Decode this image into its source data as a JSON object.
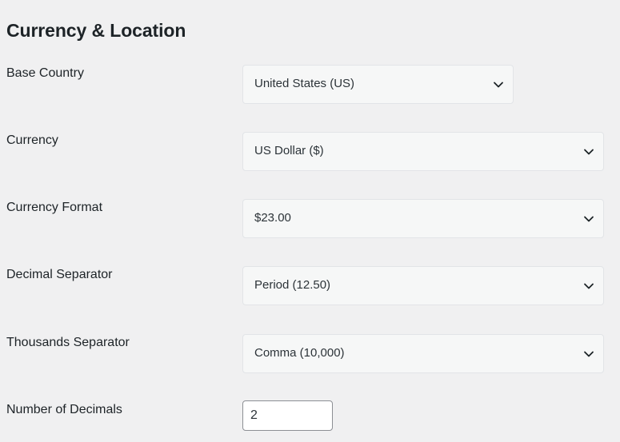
{
  "section": {
    "title": "Currency & Location"
  },
  "fields": {
    "base_country": {
      "label": "Base Country",
      "value": "United States (US)"
    },
    "currency": {
      "label": "Currency",
      "value": "US Dollar ($)"
    },
    "currency_format": {
      "label": "Currency Format",
      "value": "$23.00"
    },
    "decimal_separator": {
      "label": "Decimal Separator",
      "value": "Period (12.50)"
    },
    "thousands_separator": {
      "label": "Thousands Separator",
      "value": "Comma (10,000)"
    },
    "number_of_decimals": {
      "label": "Number of Decimals",
      "value": "2"
    }
  },
  "icons": {
    "dropdown": "chevron-down-icon"
  },
  "colors": {
    "background": "#f0f0f1",
    "select_background": "#f6f7f7",
    "text": "#1d2327"
  }
}
